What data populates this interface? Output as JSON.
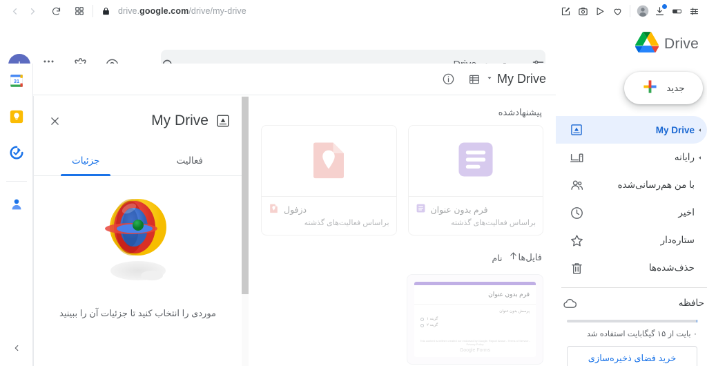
{
  "browser": {
    "url_prefix": "drive.",
    "url_domain": "google.com",
    "url_path": "/drive/my-drive",
    "back_icon": "back-arrow-icon",
    "forward_icon": "forward-arrow-icon",
    "reload_icon": "reload-icon",
    "tabs_icon": "tab-grid-icon",
    "lock_icon": "lock-icon",
    "right_icons": [
      "edit-note-icon",
      "screenshot-icon",
      "send-icon",
      "heart-icon",
      "profile-icon",
      "downloads-icon",
      "reader-mode-icon",
      "settings-sliders-icon"
    ]
  },
  "header": {
    "product_name": "Drive",
    "logo_icon": "google-drive-logo",
    "search": {
      "placeholder": "جستجو در Drive",
      "value": "",
      "search_icon": "search-icon",
      "tune_icon": "tune-icon"
    },
    "apps_icon": "apps-grid-icon",
    "settings_icon": "gear-icon",
    "help_icon": "help-circle-icon",
    "avatar_letter": "I",
    "avatar_color": "#5c6bc0"
  },
  "rail": {
    "items": [
      {
        "name": "google-calendar",
        "icon": "calendar-icon"
      },
      {
        "name": "google-keep",
        "icon": "keep-bulb-icon"
      },
      {
        "name": "google-tasks",
        "icon": "tasks-check-icon"
      },
      {
        "name": "google-contacts",
        "icon": "contacts-person-icon"
      }
    ],
    "collapse_icon": "chevron-left-icon"
  },
  "toolbar": {
    "breadcrumb": "My Drive",
    "caret_icon": "chevron-down-icon",
    "info_icon": "info-circle-icon",
    "list_view_icon": "list-view-icon"
  },
  "details_panel": {
    "title": "My Drive",
    "drive_icon": "my-drive-box-icon",
    "close_icon": "close-icon",
    "tabs": [
      {
        "label": "فعالیت",
        "active": false
      },
      {
        "label": "جزئیات",
        "active": true
      }
    ],
    "empty_caption": "موردی را انتخاب کنید تا جزئیات آن را ببینید",
    "illustration": "nested-sphere-illustration"
  },
  "main": {
    "suggested_label": "پیشنهادشده",
    "suggested": [
      {
        "name": "فرم بدون عنوان",
        "subtitle": "براساس فعالیت‌های گذشته",
        "type": "google-forms",
        "color": "#a78bda",
        "icon": "forms-icon"
      },
      {
        "name": "دزفول",
        "subtitle": "براساس فعالیت‌های گذشته",
        "type": "google-my-maps",
        "color": "#ec9a93",
        "icon": "my-maps-pin-icon"
      }
    ],
    "files_label": "فایل‌ها",
    "sort_label": "نام",
    "sort_arrow_icon": "arrow-up-icon",
    "files": [
      {
        "thumb_title": "فرم بدون عنوان",
        "thumb_question": "پرسش بدون عنوان",
        "thumb_options": [
          "گزینه ۱",
          "گزینه ۲"
        ],
        "thumb_fine_print": "This content is neither created nor endorsed by Google. Report Abuse - Terms of Service - Privacy Policy",
        "thumb_brand": "Google Forms",
        "accent": "#8e6fd0"
      }
    ]
  },
  "right_nav": {
    "new_button": {
      "label": "جدید",
      "icon": "plus-colored-icon"
    },
    "items": [
      {
        "label": "My Drive",
        "icon": "my-drive-box-icon",
        "active": true,
        "expandable": true
      },
      {
        "label": "رایانه",
        "icon": "computer-icon",
        "active": false,
        "expandable": true
      },
      {
        "label": "با من هم‌رسانی‌شده",
        "icon": "shared-people-icon",
        "active": false,
        "expandable": false
      },
      {
        "label": "اخیر",
        "icon": "clock-icon",
        "active": false,
        "expandable": false
      },
      {
        "label": "ستاره‌دار",
        "icon": "star-icon",
        "active": false,
        "expandable": false
      },
      {
        "label": "حذف‌شده‌ها",
        "icon": "trash-icon",
        "active": false,
        "expandable": false
      }
    ],
    "storage": {
      "label": "حافظه",
      "icon": "cloud-icon",
      "usage_text": "۰ بایت از ۱۵ گیگابایت استفاده شد",
      "used_percent": 0,
      "buy_button": "خرید فضای ذخیره‌سازی"
    }
  },
  "colors": {
    "accent_blue": "#1a73e8",
    "active_bg": "#e8f0fe",
    "text_primary": "#3c4043",
    "text_secondary": "#5f6368"
  }
}
